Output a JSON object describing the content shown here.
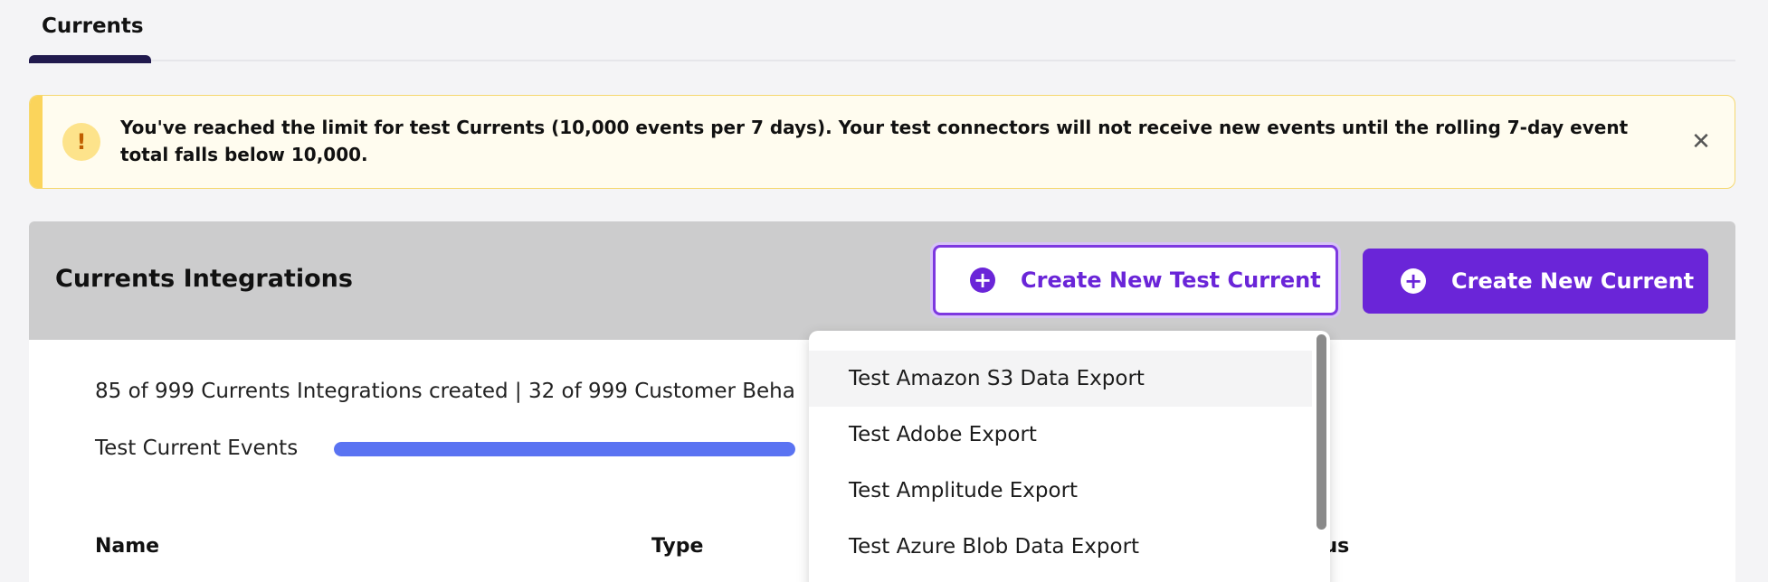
{
  "tabs": [
    {
      "label": "Currents",
      "active": true
    }
  ],
  "banner": {
    "icon": "warning-icon",
    "icon_glyph": "!",
    "message": "You've reached the limit for test Currents (10,000 events per 7 days). Your test connectors will not receive new events until the rolling 7-day event total falls below 10,000.",
    "close_glyph": "✕"
  },
  "card": {
    "title": "Currents Integrations",
    "create_test_button": "Create New Test Current",
    "create_button": "Create New Current",
    "stats_text": "85 of 999 Currents Integrations created | 32 of 999 Customer Beha",
    "events_label": "Test Current Events",
    "events_progress_fraction": 1.0,
    "columns": {
      "name": "Name",
      "type": "Type",
      "status": "tus"
    }
  },
  "dropdown": {
    "items": [
      "Test Amazon S3 Data Export",
      "Test Adobe Export",
      "Test Amplitude Export",
      "Test Azure Blob Data Export"
    ],
    "highlighted_index": 0
  },
  "colors": {
    "accent": "#6a25d8",
    "banner_bg": "#fffcef",
    "banner_stripe": "#fbd45b",
    "progress": "#5a73f2",
    "header_bg": "#cccccd"
  }
}
